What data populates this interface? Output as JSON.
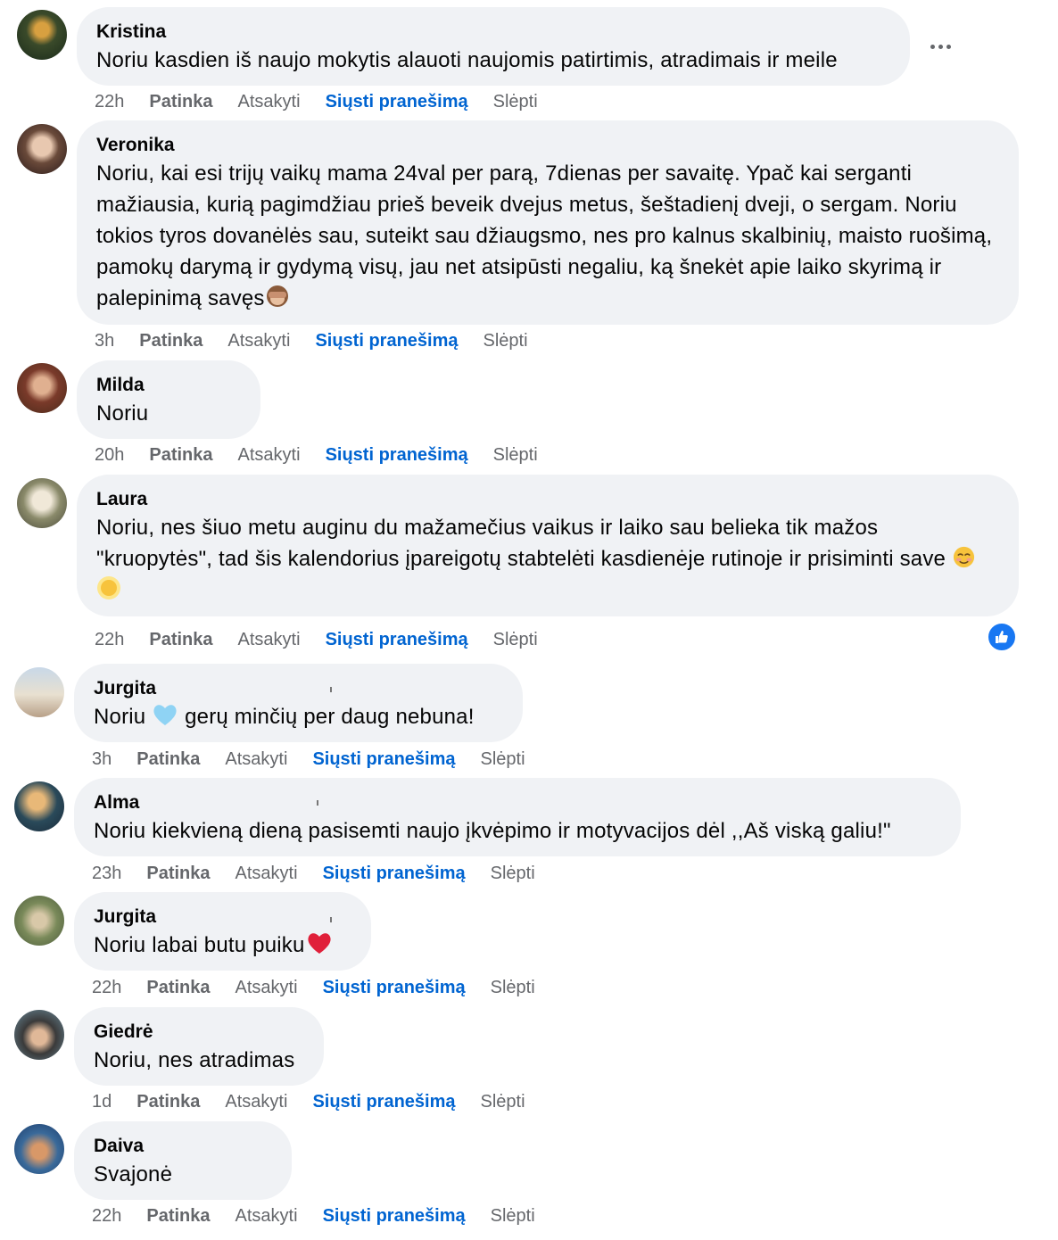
{
  "comments": [
    {
      "author": "Kristina",
      "text": "Noriu kasdien iš naujo mokytis alauoti naujomis patirtimis, atradimais ir meile",
      "time": "22h",
      "avatar_color": "#3a4a2a"
    },
    {
      "author": "Veronika",
      "text": "Noriu, kai esi trijų vaikų mama 24val per parą, 7dienas per savaitę. Ypač kai serganti mažiausia, kurią pagimdžiau prieš beveik dvejus metus, šeštadienį dveji, o sergam. Noriu tokios tyros dovanėlės sau, suteikt sau džiaugsmo, nes pro kalnus skalbinių, maisto ruošimą, pamokų darymą ir gydymą visų, jau net atsipūsti negaliu, ką šnekėt apie laiko skyrimą ir palepinimą savęs",
      "time": "3h",
      "avatar_color": "#8a6a5a"
    },
    {
      "author": "Milda",
      "text": "Noriu",
      "time": "20h",
      "avatar_color": "#7a3a2a"
    },
    {
      "author": "Laura",
      "text": "Noriu, nes šiuo metu auginu du mažamečius vaikus ir laiko sau belieka tik mažos \"kruopytės\", tad šis kalendorius įpareigotų stabtelėti kasdienėje rutinoje ir prisiminti save",
      "time": "22h",
      "avatar_color": "#c8c0a8"
    },
    {
      "author": "Jurgita",
      "text_pre": "Noriu",
      "text_post": "gerų minčių per daug nebuna!",
      "time": "3h",
      "avatar_color": "#a8b8c8"
    },
    {
      "author": "Alma",
      "text": "Noriu kiekvieną dieną pasisemti naujo įkvėpimo ir motyvacijos dėl ,,Aš viską galiu!\"",
      "time": "23h",
      "avatar_color": "#2a4a5a"
    },
    {
      "author": "Jurgita",
      "text": "Noriu labai butu puiku",
      "time": "22h",
      "avatar_color": "#7a8a5a"
    },
    {
      "author": "Giedrė",
      "text": "Noriu, nes atradimas",
      "time": "1d",
      "avatar_color": "#5a7a8a"
    },
    {
      "author": "Daiva",
      "text": "Svajonė",
      "time": "22h",
      "avatar_color": "#3a6a9a"
    }
  ],
  "actions": {
    "like": "Patinka",
    "reply": "Atsakyti",
    "send": "Siųsti pranešimą",
    "hide": "Slėpti"
  },
  "icons": {
    "more": "more-options-icon",
    "like_reaction": "thumbs-up-icon",
    "emoji_monkey": "see-no-evil-monkey-emoji",
    "emoji_smile": "smiling-face-emoji",
    "emoji_sun": "sun-emoji",
    "emoji_heart_blue": "light-blue-heart-emoji",
    "emoji_heart_red": "red-heart-emoji"
  },
  "colors": {
    "bubble": "#f0f2f5",
    "link": "#0064d1",
    "meta": "#65676b",
    "like_badge": "#1877f2"
  }
}
